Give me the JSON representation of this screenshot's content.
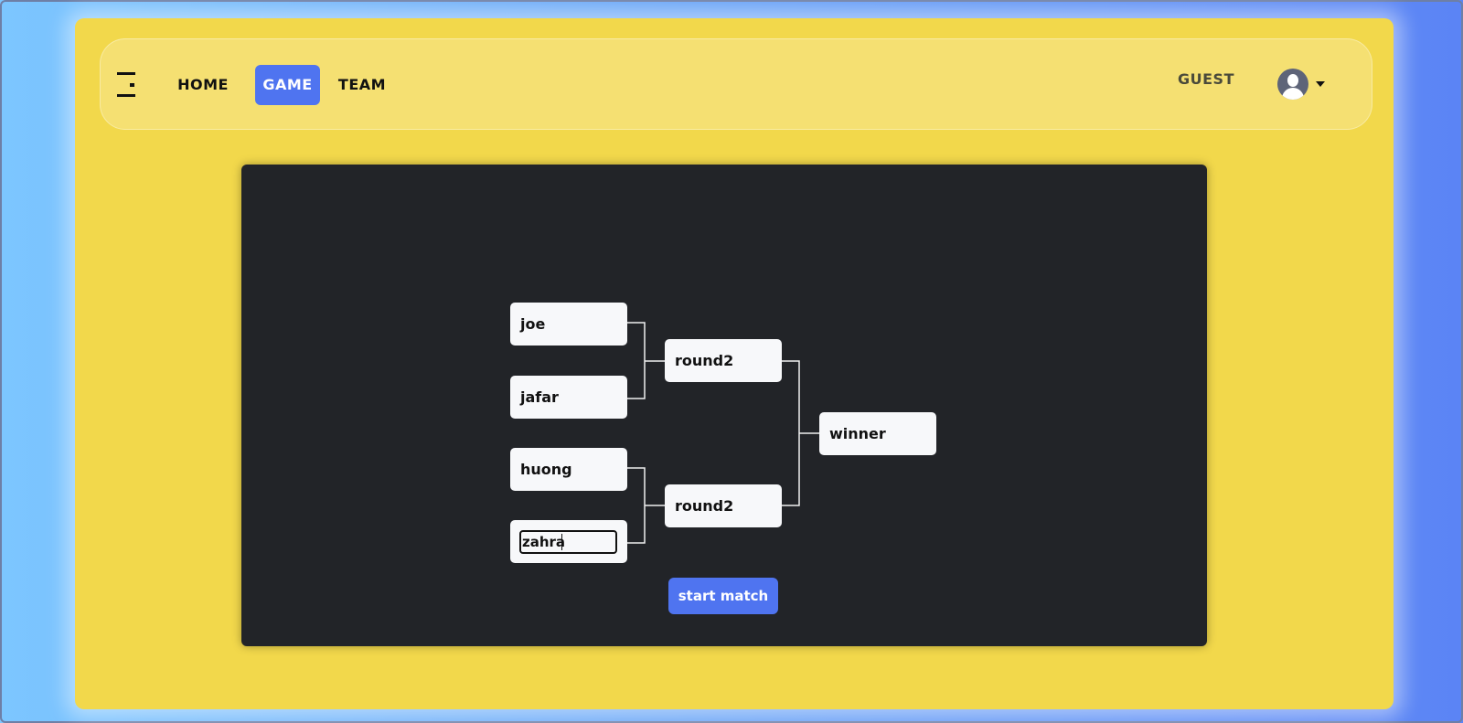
{
  "nav": {
    "home_label": "HOME",
    "game_label": "GAME",
    "team_label": "TEAM",
    "active": "GAME"
  },
  "user": {
    "name": "GUEST"
  },
  "bracket": {
    "round1": [
      "joe",
      "jafar",
      "huong"
    ],
    "input_value": "zahra",
    "round2": [
      "round2",
      "round2"
    ],
    "final": "winner"
  },
  "actions": {
    "start_label": "start match"
  },
  "colors": {
    "accent": "#4f74f0",
    "panel": "#f2d84b",
    "board": "#222428"
  }
}
